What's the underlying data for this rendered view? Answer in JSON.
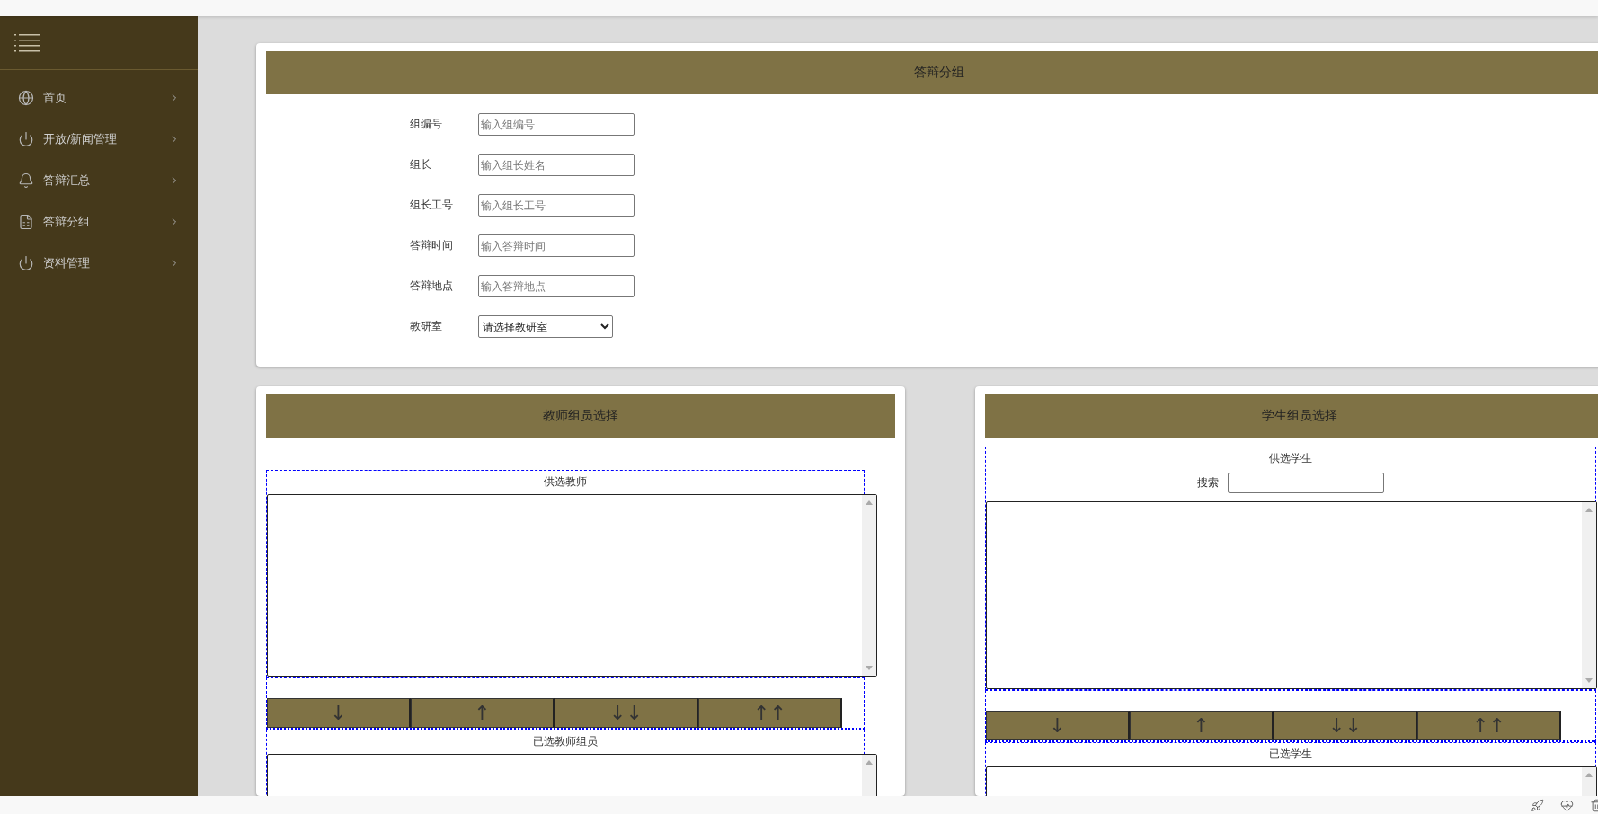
{
  "sidebar": {
    "items": [
      {
        "label": "首页"
      },
      {
        "label": "开放/新闻管理"
      },
      {
        "label": "答辩汇总"
      },
      {
        "label": "答辩分组"
      },
      {
        "label": "资料管理"
      }
    ]
  },
  "group_form": {
    "title": "答辩分组",
    "fields": [
      {
        "kind": "input",
        "label": "组编号",
        "placeholder": "输入组编号"
      },
      {
        "kind": "input",
        "label": "组长",
        "placeholder": "输入组长姓名"
      },
      {
        "kind": "input",
        "label": "组长工号",
        "placeholder": "输入组长工号"
      },
      {
        "kind": "input",
        "label": "答辩时间",
        "placeholder": "输入答辩时间"
      },
      {
        "kind": "input",
        "label": "答辩地点",
        "placeholder": "输入答辩地点"
      },
      {
        "kind": "select",
        "label": "教研室",
        "value": "请选择教研室"
      }
    ]
  },
  "panels": [
    {
      "title": "教师组员选择",
      "available_label": "供选教师",
      "move_buttons": [
        "↓",
        "↑",
        "↓↓",
        "↑↑"
      ],
      "selected_label": "已选教师组员"
    },
    {
      "title": "学生组员选择",
      "available_label": "供选学生",
      "search_label": "搜索",
      "move_buttons": [
        "↓",
        "↑",
        "↓↓",
        "↑↑"
      ],
      "selected_label": "已选学生"
    }
  ]
}
